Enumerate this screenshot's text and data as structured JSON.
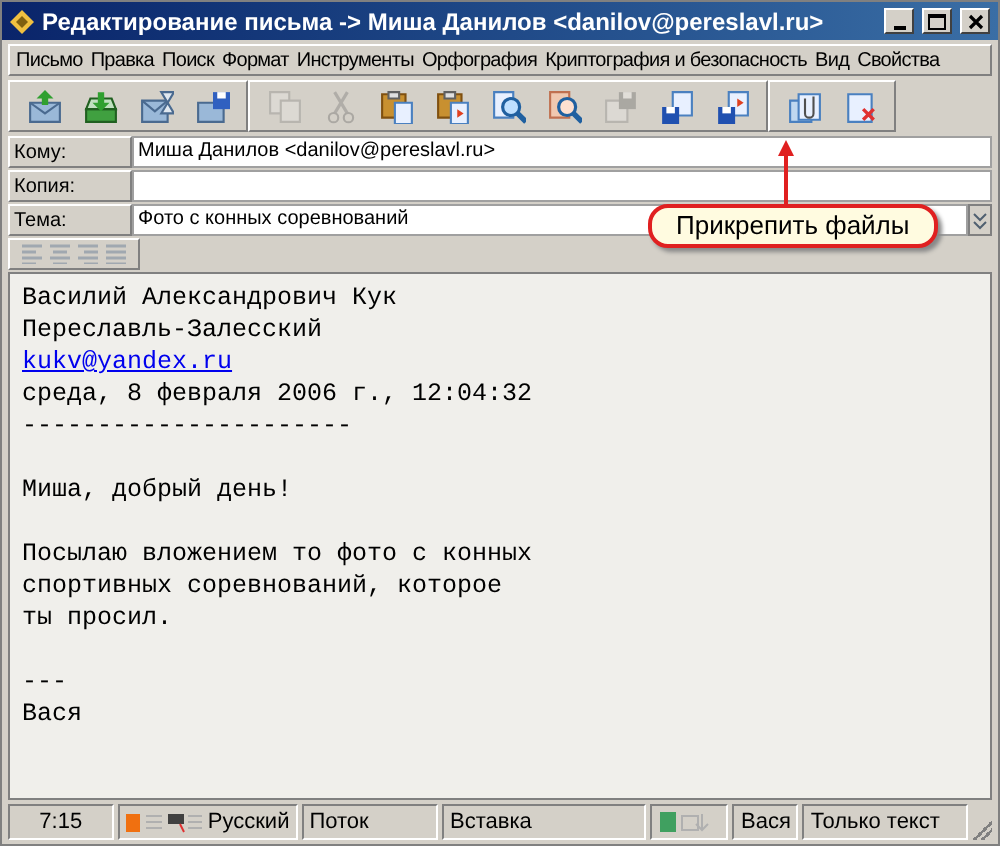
{
  "window": {
    "title": "Редактирование письма -> Миша Данилов <danilov@pereslavl.ru>"
  },
  "menu": [
    {
      "label": "Письмо"
    },
    {
      "label": "Правка"
    },
    {
      "label": "Поиск"
    },
    {
      "label": "Формат"
    },
    {
      "label": "Инструменты"
    },
    {
      "label": "Орфография"
    },
    {
      "label": "Криптография и безопасность"
    },
    {
      "label": "Вид"
    },
    {
      "label": "Свойства"
    }
  ],
  "toolbar": [
    [
      {
        "kind": "send",
        "disabled": false
      },
      {
        "kind": "receive",
        "disabled": false
      },
      {
        "kind": "later",
        "disabled": false
      },
      {
        "kind": "save-mail",
        "disabled": false
      }
    ],
    [
      {
        "kind": "copy",
        "disabled": true
      },
      {
        "kind": "cut",
        "disabled": true
      },
      {
        "kind": "paste",
        "disabled": false
      },
      {
        "kind": "paste-special",
        "disabled": false
      },
      {
        "kind": "find",
        "disabled": false
      },
      {
        "kind": "replace",
        "disabled": false
      },
      {
        "kind": "save-disabled",
        "disabled": true
      },
      {
        "kind": "save-doc",
        "disabled": false
      },
      {
        "kind": "save-doc2",
        "disabled": false
      }
    ],
    [
      {
        "kind": "attach",
        "disabled": false
      },
      {
        "kind": "delete",
        "disabled": false
      }
    ]
  ],
  "fields": [
    {
      "label": "Кому:",
      "value": "Миша Данилов <danilov@pereslavl.ru>"
    },
    {
      "label": "Копия:"
    },
    {
      "label": "Тема:",
      "value": "Фото с конных соревнований"
    }
  ],
  "callout": "Прикрепить файлы",
  "body": [
    {
      "kind": "text",
      "text": "Василий Александрович Кук"
    },
    {
      "kind": "text",
      "text": "Переславль-Залесский"
    },
    {
      "kind": "link",
      "text": "kukv@yandex.ru"
    },
    {
      "kind": "text",
      "text": "среда, 8 февраля 2006 г., 12:04:32"
    },
    {
      "kind": "text",
      "text": "----------------------"
    },
    {
      "kind": "blank"
    },
    {
      "kind": "text",
      "text": "Миша, добрый день!"
    },
    {
      "kind": "blank"
    },
    {
      "kind": "text",
      "text": "Посылаю вложением то фото с конных"
    },
    {
      "kind": "text",
      "text": "спортивных соревнований, которое"
    },
    {
      "kind": "text",
      "text": "ты просил."
    },
    {
      "kind": "blank"
    },
    {
      "kind": "text",
      "text": "---"
    },
    {
      "kind": "text",
      "text": "Вася"
    }
  ],
  "status_bar": {
    "time": "7:15",
    "language": "Русский",
    "mode": "Поток",
    "insert": "Вставка",
    "sender": "Вася",
    "format": "Только текст"
  }
}
